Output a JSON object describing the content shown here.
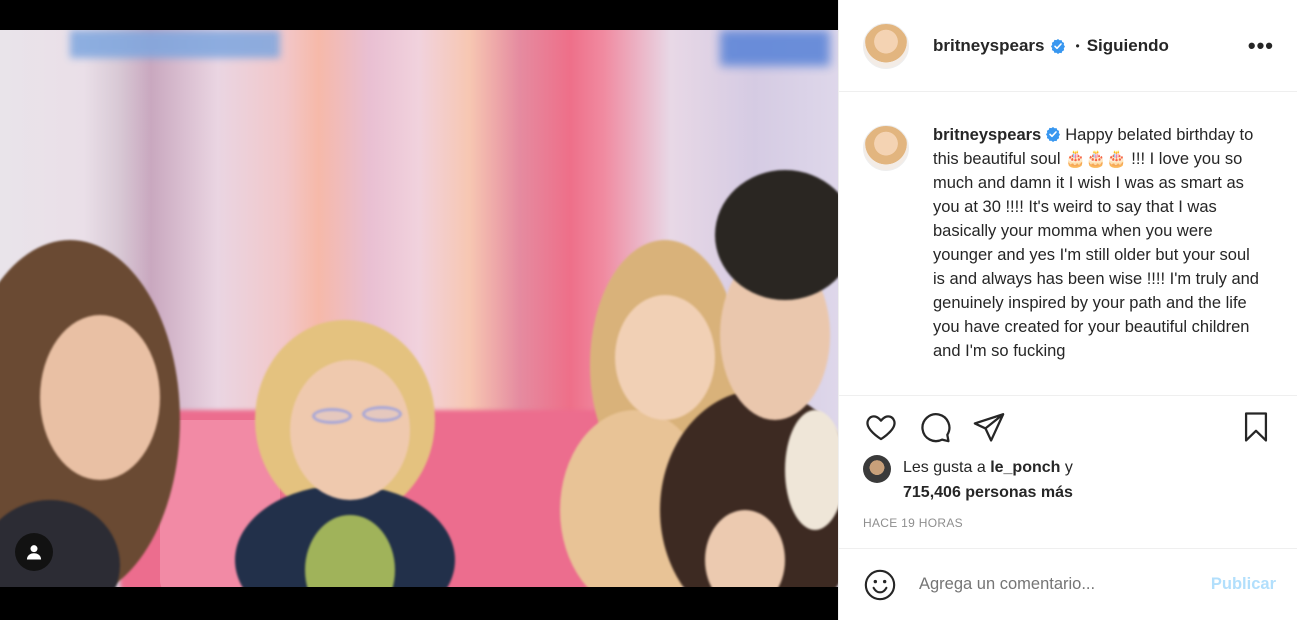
{
  "post": {
    "username": "britneyspears",
    "separator": "•",
    "follow_status": "Siguiendo",
    "more_label": "•••"
  },
  "caption": {
    "username": "britneyspears",
    "text": "Happy belated birthday to this beautiful soul 🎂🎂🎂 !!! I love you so much and damn it I wish I was as smart as you at 30 !!!! It's weird to say that I was basically your momma when you were younger and yes I'm still older but your soul is and always has been wise !!!! I'm truly and genuinely inspired by your path and the life you have created for your beautiful children and I'm so fucking"
  },
  "likes": {
    "prefix": "Les gusta a",
    "user": "le_ponch",
    "conjunction": "y",
    "count_text": "715,406 personas más"
  },
  "timestamp": "HACE 19 HORAS",
  "comment": {
    "placeholder": "Agrega un comentario...",
    "publish_label": "Publicar"
  },
  "icons": {
    "like": "heart-icon",
    "comment": "comment-icon",
    "share": "paper-plane-icon",
    "save": "bookmark-icon",
    "emoji": "smiley-icon",
    "verified": "verified-badge-icon",
    "tag": "user-tag-icon"
  },
  "colors": {
    "verified_blue": "#3897f0",
    "publish_disabled": "#b2dffc",
    "muted_text": "#8e8e8e"
  }
}
